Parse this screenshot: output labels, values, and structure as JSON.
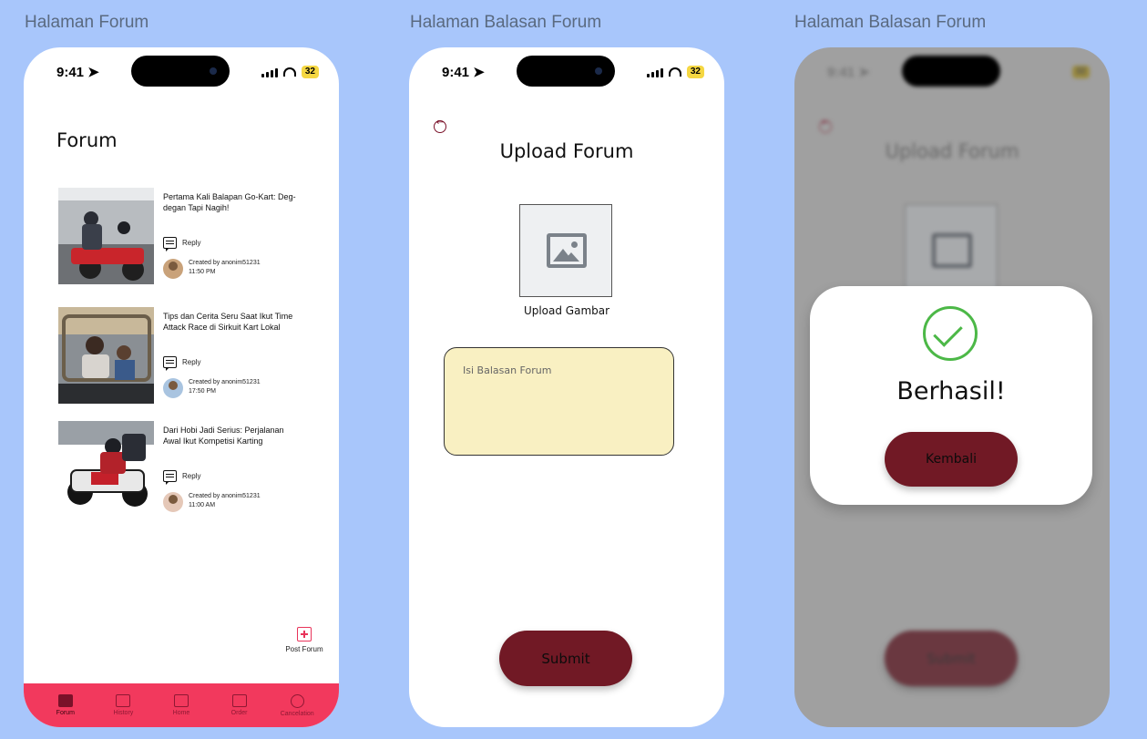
{
  "frames": [
    {
      "label": "Halaman Forum"
    },
    {
      "label": "Halaman Balasan Forum"
    },
    {
      "label": "Halaman Balasan Forum"
    }
  ],
  "status_bar": {
    "time": "9:41",
    "battery": "32"
  },
  "forum": {
    "title": "Forum",
    "reply_label": "Reply",
    "posts": [
      {
        "title": "Pertama Kali Balapan Go-Kart: Deg-degan Tapi Nagih!",
        "created_by": "Created by anonim51231",
        "time": "11:50 PM"
      },
      {
        "title": "Tips dan Cerita Seru Saat Ikut Time Attack Race di Sirkuit Kart Lokal",
        "created_by": "Created by anonim51231",
        "time": "17:50 PM"
      },
      {
        "title": "Dari Hobi Jadi Serius: Perjalanan Awal Ikut Kompetisi Karting",
        "created_by": "Created by anonim51231",
        "time": "11:00 AM"
      }
    ],
    "post_forum_label": "Post Forum",
    "nav": [
      {
        "label": "Forum",
        "icon": "truck-icon"
      },
      {
        "label": "History",
        "icon": "history-icon"
      },
      {
        "label": "Home",
        "icon": "home-icon"
      },
      {
        "label": "Order",
        "icon": "cart-icon"
      },
      {
        "label": "Cancelation",
        "icon": "cancel-icon"
      }
    ]
  },
  "upload": {
    "title": "Upload Forum",
    "image_label": "Upload Gambar",
    "textarea_placeholder": "Isi Balasan Forum",
    "submit_label": "Submit"
  },
  "success_dialog": {
    "message": "Berhasil!",
    "button_label": "Kembali"
  },
  "colors": {
    "background": "#a8c6fb",
    "nav_bar": "#f2395d",
    "primary_button": "#711925",
    "textarea_bg": "#f9f0c2",
    "success_green": "#4cb847"
  }
}
